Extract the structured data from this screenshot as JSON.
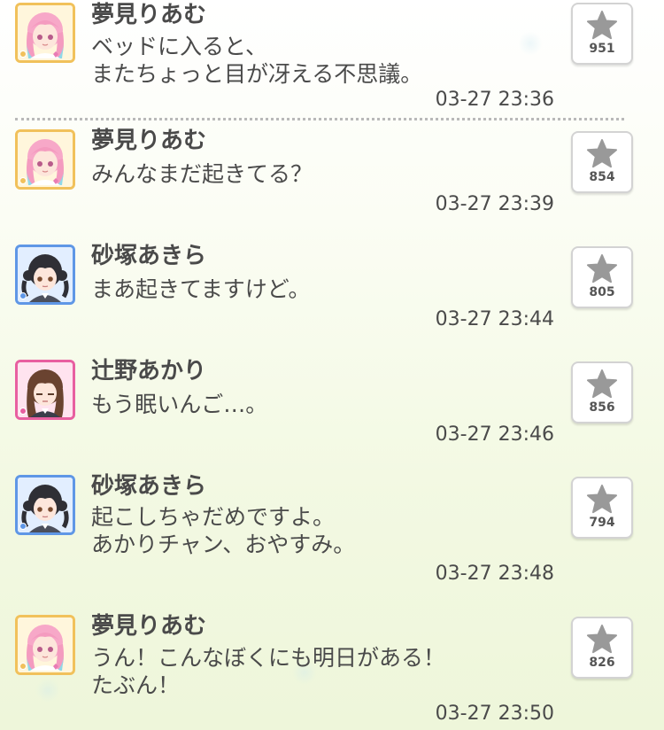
{
  "posts": [
    {
      "name": "夢見りあむ",
      "lines": [
        "ベッドに入ると、",
        "またちょっと目が冴える不思議。"
      ],
      "time": "03-27 23:36",
      "likes": "951",
      "avatar": "riamu-avatar",
      "frame_color": "#f1c15b"
    },
    {
      "name": "夢見りあむ",
      "lines": [
        "みんなまだ起きてる？"
      ],
      "time": "03-27 23:39",
      "likes": "854",
      "avatar": "riamu-avatar",
      "frame_color": "#f1c15b"
    },
    {
      "name": "砂塚あきら",
      "lines": [
        "まあ起きてますけど。"
      ],
      "time": "03-27 23:44",
      "likes": "805",
      "avatar": "akira-avatar",
      "frame_color": "#5f97e6"
    },
    {
      "name": "辻野あかり",
      "lines": [
        "もう眠いんご…。"
      ],
      "time": "03-27 23:46",
      "likes": "856",
      "avatar": "akari-avatar",
      "frame_color": "#e85fa0"
    },
    {
      "name": "砂塚あきら",
      "lines": [
        "起こしちゃだめですよ。",
        "あかりチャン、おやすみ。"
      ],
      "time": "03-27 23:48",
      "likes": "794",
      "avatar": "akira-avatar",
      "frame_color": "#5f97e6"
    },
    {
      "name": "夢見りあむ",
      "lines": [
        "うん！こんなぼくにも明日がある！",
        "たぶん！"
      ],
      "time": "03-27 23:50",
      "likes": "826",
      "avatar": "riamu-avatar",
      "frame_color": "#f1c15b"
    }
  ],
  "icons": {
    "like": "star-icon"
  },
  "colors": {
    "text": "#4a4a4a",
    "star": "#999999"
  }
}
